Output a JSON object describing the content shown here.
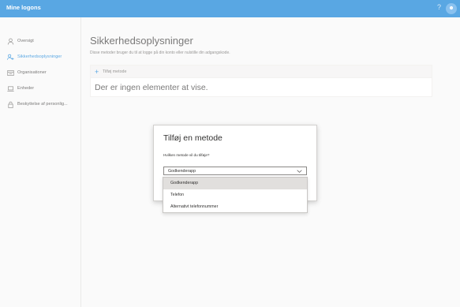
{
  "app": {
    "title": "Mine logons",
    "help": "?",
    "avatar_icon": "user-avatar-icon"
  },
  "sidebar": {
    "items": [
      {
        "label": "Oversigt",
        "icon": "person-icon",
        "active": false
      },
      {
        "label": "Sikkerhedsoplysninger",
        "icon": "security-info-icon",
        "active": true
      },
      {
        "label": "Organisationer",
        "icon": "organization-icon",
        "active": false
      },
      {
        "label": "Enheder",
        "icon": "laptop-icon",
        "active": false
      },
      {
        "label": "Beskyttelse af personlig...",
        "icon": "lock-icon",
        "active": false
      }
    ]
  },
  "main": {
    "title": "Sikkerhedsoplysninger",
    "subtitle": "Disse metoder bruger du til at logge på din konto eller nulstille din adgangskode.",
    "add_method": "Tilføj metode",
    "empty_text": "Der er ingen elementer at vise."
  },
  "dialog": {
    "title": "Tilføj en metode",
    "question": "Hvilken metode vil du tilføje?",
    "selected": "Godkenderapp",
    "options": [
      "Godkenderapp",
      "Telefon",
      "Alternativt telefonnummer"
    ]
  },
  "colors": {
    "accent": "#0078d4",
    "selected_option": "#e1dfdd"
  }
}
